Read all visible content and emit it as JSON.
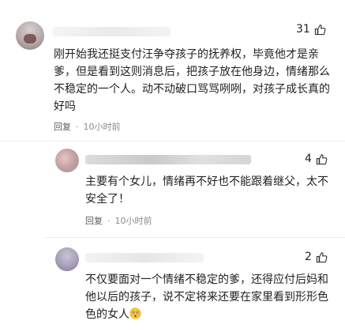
{
  "comments": [
    {
      "likes": "31",
      "text": "刚开始我还挺支付汪争夺孩子的抚养权，毕竟他才是亲爹，但是看到这则消息后，把孩子放在他身边，情绪那么不稳定的一个人。动不动破口骂骂咧咧，对孩子成长真的好吗",
      "reply_label": "回复",
      "dot": "·",
      "time": "10小时前"
    },
    {
      "likes": "4",
      "text": "主要有个女儿，情绪再不好也不能跟着继父，太不安全了！",
      "reply_label": "回复",
      "dot": "·",
      "time": "10小时前"
    },
    {
      "likes": "2",
      "text": "不仅要面对一个情绪不稳定的爹，还得应付后妈和他以后的孩子，说不定将来还要在家里看到形形色色的女人",
      "emoji": "flushed-face-emoji"
    }
  ]
}
